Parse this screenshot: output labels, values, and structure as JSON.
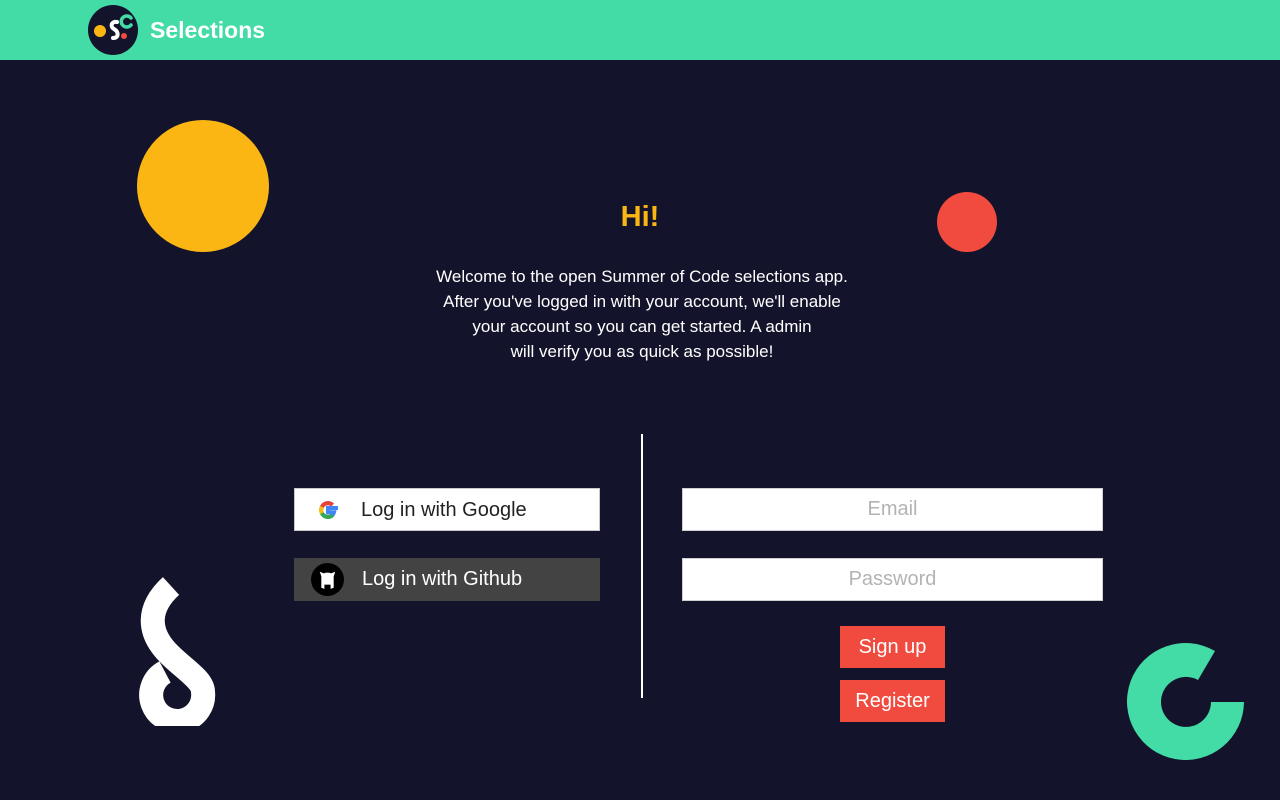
{
  "header": {
    "app_title": "Selections",
    "logo_icon": "osc-logo-icon"
  },
  "welcome": {
    "heading": "Hi!",
    "intro_lines": [
      "Welcome to the open Summer of Code selections app.",
      "After you've logged in with your account, we'll enable",
      "your account so you can get started. A admin",
      "will verify you as quick as possible!"
    ]
  },
  "social_login": {
    "google_label": "Log in with Google",
    "google_icon": "google-icon",
    "github_label": "Log in with Github",
    "github_icon": "github-icon"
  },
  "form": {
    "email_placeholder": "Email",
    "password_placeholder": "Password",
    "signup_label": "Sign up",
    "register_label": "Register"
  },
  "colors": {
    "header_bg": "#43dca7",
    "page_bg": "#13142b",
    "accent_yellow": "#fbb614",
    "accent_red": "#f04b3e",
    "github_button_bg": "#434343"
  }
}
